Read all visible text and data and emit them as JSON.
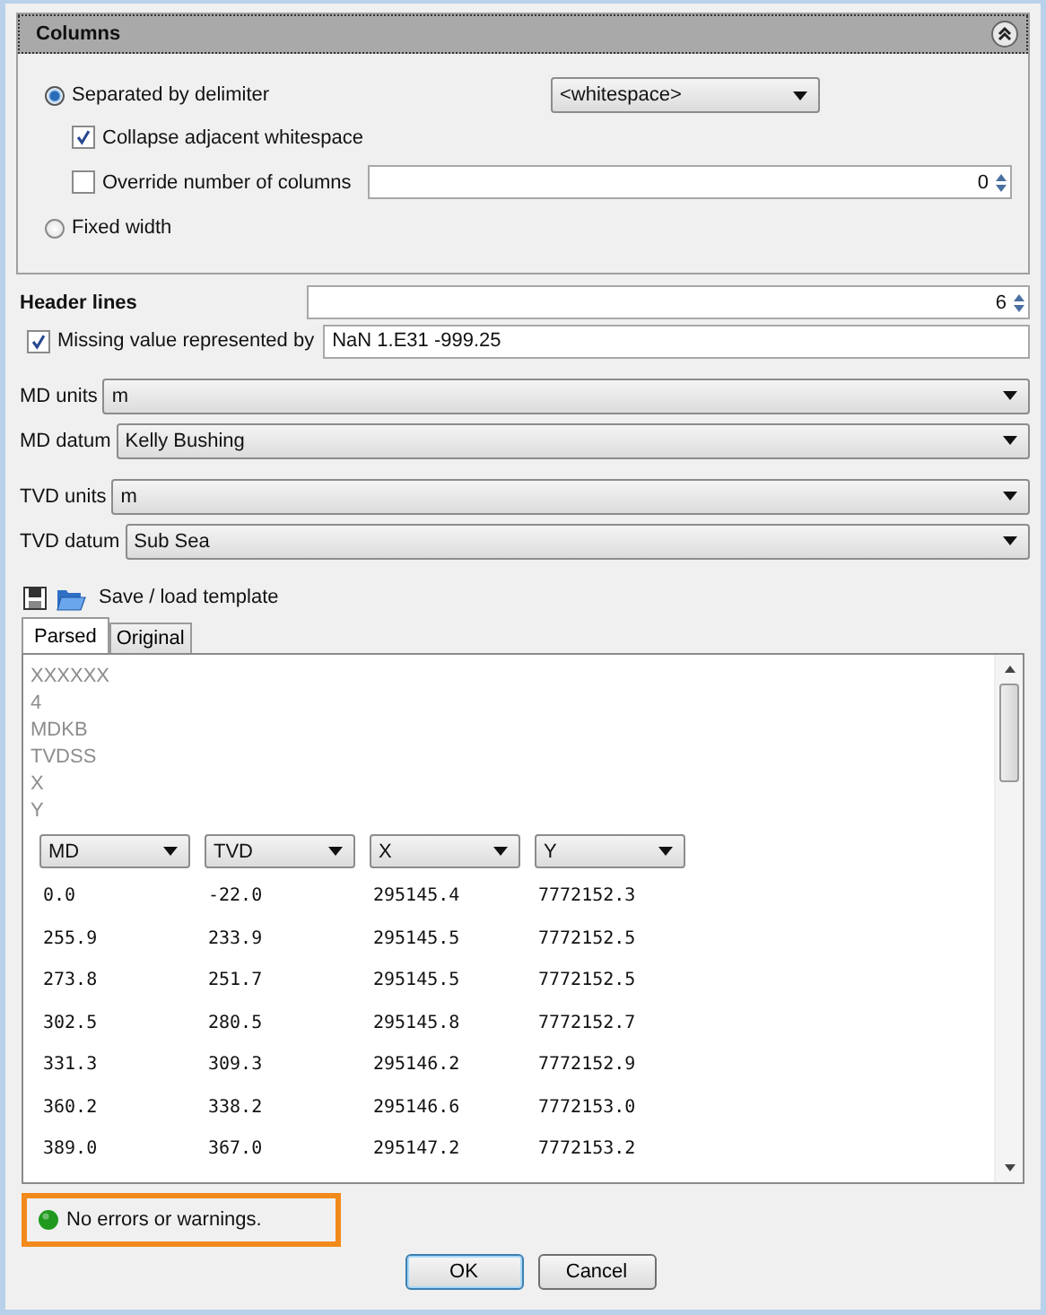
{
  "panel": {
    "title": "Columns",
    "expanded": true
  },
  "delimiter_modes": [
    {
      "label": "Separated by delimiter",
      "selected": true
    },
    {
      "label": "Fixed width",
      "selected": false
    }
  ],
  "delimiter": {
    "value": "<whitespace>"
  },
  "collapse_whitespace": {
    "label": "Collapse adjacent whitespace",
    "checked": true
  },
  "override_columns": {
    "label": "Override number of columns",
    "checked": false,
    "value": "0"
  },
  "header_lines": {
    "label": "Header lines",
    "value": "6"
  },
  "missing_value": {
    "label": "Missing value represented by",
    "checked": true,
    "value": "NaN 1.E31 -999.25"
  },
  "unit_groups": [
    [
      {
        "label": "MD units",
        "value": "m"
      },
      {
        "label": "MD datum",
        "value": "Kelly Bushing"
      }
    ],
    [
      {
        "label": "TVD units",
        "value": "m"
      },
      {
        "label": "TVD datum",
        "value": "Sub Sea"
      }
    ]
  ],
  "template": {
    "label": "Save / load template"
  },
  "tabs": [
    {
      "label": "Parsed",
      "selected": true
    },
    {
      "label": "Original",
      "selected": false
    }
  ],
  "header_text": [
    "XXXXXX",
    "4",
    "MDKB",
    "TVDSS",
    "X",
    "Y"
  ],
  "column_selectors": [
    "MD",
    "TVD",
    "X",
    "Y"
  ],
  "rows": [
    [
      "0.0",
      "-22.0",
      "295145.4",
      "7772152.3"
    ],
    [
      "255.9",
      "233.9",
      "295145.5",
      "7772152.5"
    ],
    [
      "273.8",
      "251.7",
      "295145.5",
      "7772152.5"
    ],
    [
      "302.5",
      "280.5",
      "295145.8",
      "7772152.7"
    ],
    [
      "331.3",
      "309.3",
      "295146.2",
      "7772152.9"
    ],
    [
      "360.2",
      "338.2",
      "295146.6",
      "7772153.0"
    ],
    [
      "389.0",
      "367.0",
      "295147.2",
      "7772153.2"
    ]
  ],
  "status": {
    "kind": "ok",
    "text": "No errors or warnings."
  },
  "buttons": [
    {
      "label": "OK",
      "default": true
    },
    {
      "label": "Cancel",
      "default": false
    }
  ]
}
